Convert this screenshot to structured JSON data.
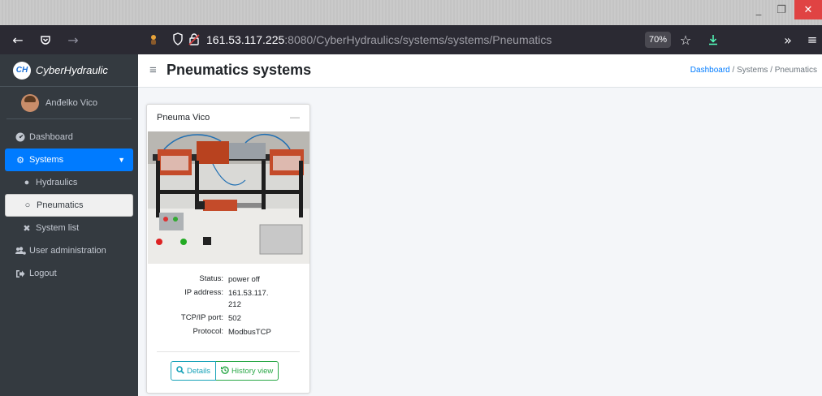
{
  "browser": {
    "url_host": "161.53.117.225",
    "url_rest": ":8080/CyberHydraulics/systems/systems/Pneumatics",
    "zoom": "70%"
  },
  "app": {
    "brand_logo": "CH",
    "brand_name": "CyberHydraulic",
    "user_name": "Anđelko Vico"
  },
  "sidebar": {
    "items": [
      {
        "label": "Dashboard",
        "icon": "dashboard-icon"
      },
      {
        "label": "Systems",
        "icon": "cogs-icon"
      },
      {
        "label": "Hydraulics",
        "icon": "circle-filled-icon"
      },
      {
        "label": "Pneumatics",
        "icon": "circle-outline-icon"
      },
      {
        "label": "System list",
        "icon": "tools-icon"
      },
      {
        "label": "User administration",
        "icon": "users-cog-icon"
      },
      {
        "label": "Logout",
        "icon": "sign-out-icon"
      }
    ]
  },
  "header": {
    "title": "Pneumatics systems",
    "breadcrumb": [
      "Dashboard",
      "Systems",
      "Pneumatics"
    ],
    "separator": "/"
  },
  "card": {
    "title": "Pneuma Vico",
    "fields": [
      {
        "label": "Status:",
        "value": "power off"
      },
      {
        "label": "IP address:",
        "value": "161.53.117.\n212"
      },
      {
        "label": "TCP/IP port:",
        "value": "502"
      },
      {
        "label": "Protocol:",
        "value": "ModbusTCP"
      }
    ],
    "details_label": "Details",
    "history_label": "History view"
  },
  "colors": {
    "primary": "#007bff",
    "sidebar_bg": "#343a40",
    "success": "#28a745",
    "info": "#17a2b8"
  }
}
